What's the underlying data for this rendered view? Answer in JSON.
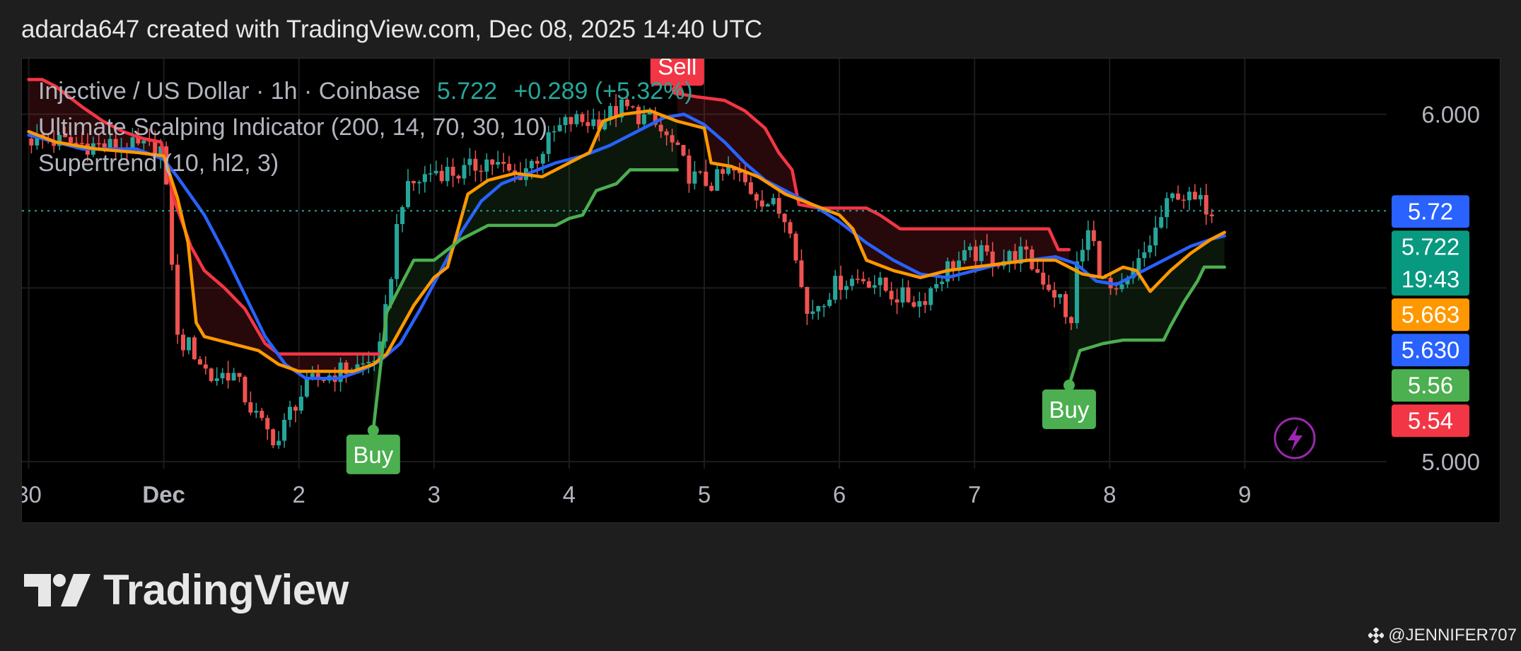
{
  "header": {
    "text": "adarda647 created with TradingView.com, Dec 08, 2025 14:40 UTC"
  },
  "legend": {
    "symbol_line": "Injective / US Dollar · 1h · Coinbase",
    "price": "5.722",
    "change": "+0.289 (+5.32%)",
    "indicator_line": "Ultimate Scalping Indicator (200, 14, 70, 30, 10)",
    "supertrend_line": "Supertrend (10, hl2, 3)"
  },
  "brand": {
    "logo_text": "TradingView",
    "watermark": "@JENNIFER707"
  },
  "colors": {
    "up": "#26a69a",
    "down": "#ef5350",
    "blue": "#2962ff",
    "orange": "#ff9800",
    "green": "#4caf50",
    "red": "#f23645",
    "signal_icon": "#9c27b0"
  },
  "chart_data": {
    "type": "line",
    "ylim": [
      4.98,
      6.16
    ],
    "xlim": [
      -0.05,
      10.05
    ],
    "x_ticks": [
      {
        "x": 0,
        "label": "30"
      },
      {
        "x": 1,
        "label": "Dec"
      },
      {
        "x": 2,
        "label": "2"
      },
      {
        "x": 3,
        "label": "3"
      },
      {
        "x": 4,
        "label": "4"
      },
      {
        "x": 5,
        "label": "5"
      },
      {
        "x": 6,
        "label": "6"
      },
      {
        "x": 7,
        "label": "7"
      },
      {
        "x": 8,
        "label": "8"
      },
      {
        "x": 9,
        "label": "9"
      }
    ],
    "y_ticks": [
      5.0,
      6.0
    ],
    "grid": true,
    "last_price": 5.722,
    "countdown": "19:43",
    "price_labels": [
      {
        "value": 5.72,
        "text": "5.72",
        "color": "#2962ff"
      },
      {
        "value": 5.722,
        "text": "5.722",
        "sub": "19:43",
        "color": "#089981"
      },
      {
        "value": 5.663,
        "text": "5.663",
        "color": "#ff9800"
      },
      {
        "value": 5.63,
        "text": "5.630",
        "color": "#2962ff"
      },
      {
        "value": 5.56,
        "text": "5.56",
        "color": "#4caf50"
      },
      {
        "value": 5.54,
        "text": "5.54",
        "color": "#f23645"
      }
    ],
    "signals": [
      {
        "label": "Buy",
        "x": 2.55,
        "y": 5.09,
        "color": "#4caf50",
        "dir": "up"
      },
      {
        "label": "Sell",
        "x": 4.8,
        "y": 6.07,
        "color": "#f23645",
        "dir": "down"
      },
      {
        "label": "Buy",
        "x": 7.7,
        "y": 5.22,
        "color": "#4caf50",
        "dir": "up"
      }
    ],
    "series": [
      {
        "name": "",
        "color": "#f23645",
        "points": [
          [
            0,
            6.1
          ],
          [
            0.1,
            6.1
          ],
          [
            0.2,
            6.08
          ],
          [
            0.3,
            6.05
          ],
          [
            0.4,
            6.02
          ],
          [
            0.55,
            5.98
          ],
          [
            0.7,
            5.95
          ],
          [
            0.85,
            5.93
          ],
          [
            0.98,
            5.92
          ],
          [
            1.08,
            5.75
          ],
          [
            1.2,
            5.62
          ],
          [
            1.3,
            5.55
          ],
          [
            1.45,
            5.5
          ],
          [
            1.6,
            5.44
          ],
          [
            1.75,
            5.34
          ],
          [
            1.85,
            5.31
          ],
          [
            2.0,
            5.31
          ],
          [
            2.2,
            5.31
          ],
          [
            2.4,
            5.31
          ],
          [
            2.55,
            5.31
          ],
          [
            2.6,
            5.31
          ]
        ]
      },
      {
        "name": "",
        "color": "#f23645",
        "points": [
          [
            4.8,
            6.06
          ],
          [
            4.95,
            6.05
          ],
          [
            5.15,
            6.04
          ],
          [
            5.3,
            6.01
          ],
          [
            5.45,
            5.96
          ],
          [
            5.55,
            5.89
          ],
          [
            5.65,
            5.84
          ],
          [
            5.7,
            5.74
          ],
          [
            5.85,
            5.73
          ],
          [
            6.0,
            5.73
          ],
          [
            6.2,
            5.73
          ],
          [
            6.3,
            5.71
          ],
          [
            6.45,
            5.67
          ],
          [
            6.6,
            5.67
          ],
          [
            6.8,
            5.67
          ],
          [
            7.0,
            5.67
          ],
          [
            7.2,
            5.67
          ],
          [
            7.4,
            5.67
          ],
          [
            7.55,
            5.67
          ],
          [
            7.62,
            5.61
          ],
          [
            7.7,
            5.61
          ]
        ]
      },
      {
        "name": "",
        "color": "#2962ff",
        "points": [
          [
            0,
            5.94
          ],
          [
            0.2,
            5.92
          ],
          [
            0.4,
            5.9
          ],
          [
            0.6,
            5.9
          ],
          [
            0.8,
            5.9
          ],
          [
            1.0,
            5.87
          ],
          [
            1.1,
            5.82
          ],
          [
            1.3,
            5.71
          ],
          [
            1.45,
            5.6
          ],
          [
            1.6,
            5.48
          ],
          [
            1.75,
            5.36
          ],
          [
            1.9,
            5.28
          ],
          [
            2.05,
            5.24
          ],
          [
            2.3,
            5.24
          ],
          [
            2.45,
            5.26
          ],
          [
            2.6,
            5.29
          ],
          [
            2.75,
            5.34
          ],
          [
            2.9,
            5.44
          ],
          [
            3.05,
            5.55
          ],
          [
            3.2,
            5.66
          ],
          [
            3.35,
            5.75
          ],
          [
            3.5,
            5.8
          ],
          [
            3.7,
            5.83
          ],
          [
            3.9,
            5.86
          ],
          [
            4.1,
            5.88
          ],
          [
            4.3,
            5.91
          ],
          [
            4.5,
            5.95
          ],
          [
            4.7,
            5.99
          ],
          [
            4.85,
            6.0
          ],
          [
            5.0,
            5.97
          ],
          [
            5.15,
            5.92
          ],
          [
            5.3,
            5.86
          ],
          [
            5.45,
            5.81
          ],
          [
            5.6,
            5.78
          ],
          [
            5.8,
            5.74
          ],
          [
            6.0,
            5.69
          ],
          [
            6.2,
            5.63
          ],
          [
            6.4,
            5.58
          ],
          [
            6.6,
            5.54
          ],
          [
            6.8,
            5.53
          ],
          [
            7.0,
            5.55
          ],
          [
            7.2,
            5.57
          ],
          [
            7.4,
            5.58
          ],
          [
            7.6,
            5.59
          ],
          [
            7.75,
            5.57
          ],
          [
            7.9,
            5.52
          ],
          [
            8.05,
            5.51
          ],
          [
            8.2,
            5.54
          ],
          [
            8.4,
            5.58
          ],
          [
            8.6,
            5.62
          ],
          [
            8.75,
            5.64
          ],
          [
            8.85,
            5.65
          ]
        ]
      },
      {
        "name": "",
        "color": "#ff9800",
        "points": [
          [
            0,
            5.95
          ],
          [
            0.2,
            5.92
          ],
          [
            0.5,
            5.9
          ],
          [
            0.8,
            5.89
          ],
          [
            1.0,
            5.88
          ],
          [
            1.1,
            5.76
          ],
          [
            1.18,
            5.63
          ],
          [
            1.24,
            5.4
          ],
          [
            1.3,
            5.36
          ],
          [
            1.5,
            5.34
          ],
          [
            1.7,
            5.32
          ],
          [
            1.85,
            5.28
          ],
          [
            2.0,
            5.26
          ],
          [
            2.2,
            5.26
          ],
          [
            2.4,
            5.26
          ],
          [
            2.55,
            5.28
          ],
          [
            2.65,
            5.31
          ],
          [
            2.75,
            5.38
          ],
          [
            2.85,
            5.45
          ],
          [
            3.0,
            5.53
          ],
          [
            3.1,
            5.56
          ],
          [
            3.25,
            5.77
          ],
          [
            3.4,
            5.81
          ],
          [
            3.6,
            5.83
          ],
          [
            3.8,
            5.82
          ],
          [
            4.0,
            5.86
          ],
          [
            4.15,
            5.89
          ],
          [
            4.25,
            5.98
          ],
          [
            4.4,
            6.0
          ],
          [
            4.6,
            6.01
          ],
          [
            4.8,
            5.98
          ],
          [
            5.0,
            5.96
          ],
          [
            5.05,
            5.86
          ],
          [
            5.2,
            5.85
          ],
          [
            5.4,
            5.82
          ],
          [
            5.6,
            5.77
          ],
          [
            5.8,
            5.74
          ],
          [
            6.0,
            5.71
          ],
          [
            6.1,
            5.67
          ],
          [
            6.2,
            5.58
          ],
          [
            6.4,
            5.55
          ],
          [
            6.6,
            5.53
          ],
          [
            6.8,
            5.55
          ],
          [
            7.0,
            5.56
          ],
          [
            7.2,
            5.57
          ],
          [
            7.4,
            5.58
          ],
          [
            7.6,
            5.58
          ],
          [
            7.8,
            5.54
          ],
          [
            7.95,
            5.53
          ],
          [
            8.1,
            5.56
          ],
          [
            8.2,
            5.55
          ],
          [
            8.3,
            5.49
          ],
          [
            8.45,
            5.55
          ],
          [
            8.6,
            5.6
          ],
          [
            8.75,
            5.64
          ],
          [
            8.85,
            5.66
          ]
        ]
      },
      {
        "name": "",
        "color": "#4caf50",
        "points": [
          [
            2.55,
            5.09
          ],
          [
            2.65,
            5.43
          ],
          [
            2.85,
            5.58
          ],
          [
            3.0,
            5.58
          ],
          [
            3.2,
            5.64
          ],
          [
            3.4,
            5.68
          ],
          [
            3.6,
            5.68
          ],
          [
            3.9,
            5.68
          ],
          [
            4.0,
            5.7
          ],
          [
            4.1,
            5.71
          ],
          [
            4.2,
            5.78
          ],
          [
            4.35,
            5.8
          ],
          [
            4.45,
            5.84
          ],
          [
            4.55,
            5.84
          ],
          [
            4.7,
            5.84
          ],
          [
            4.8,
            5.84
          ]
        ]
      },
      {
        "name": "",
        "color": "#4caf50",
        "points": [
          [
            7.7,
            5.22
          ],
          [
            7.78,
            5.32
          ],
          [
            7.95,
            5.34
          ],
          [
            8.1,
            5.35
          ],
          [
            8.25,
            5.35
          ],
          [
            8.4,
            5.35
          ],
          [
            8.45,
            5.39
          ],
          [
            8.55,
            5.46
          ],
          [
            8.65,
            5.52
          ],
          [
            8.7,
            5.56
          ],
          [
            8.85,
            5.56
          ]
        ]
      }
    ]
  }
}
